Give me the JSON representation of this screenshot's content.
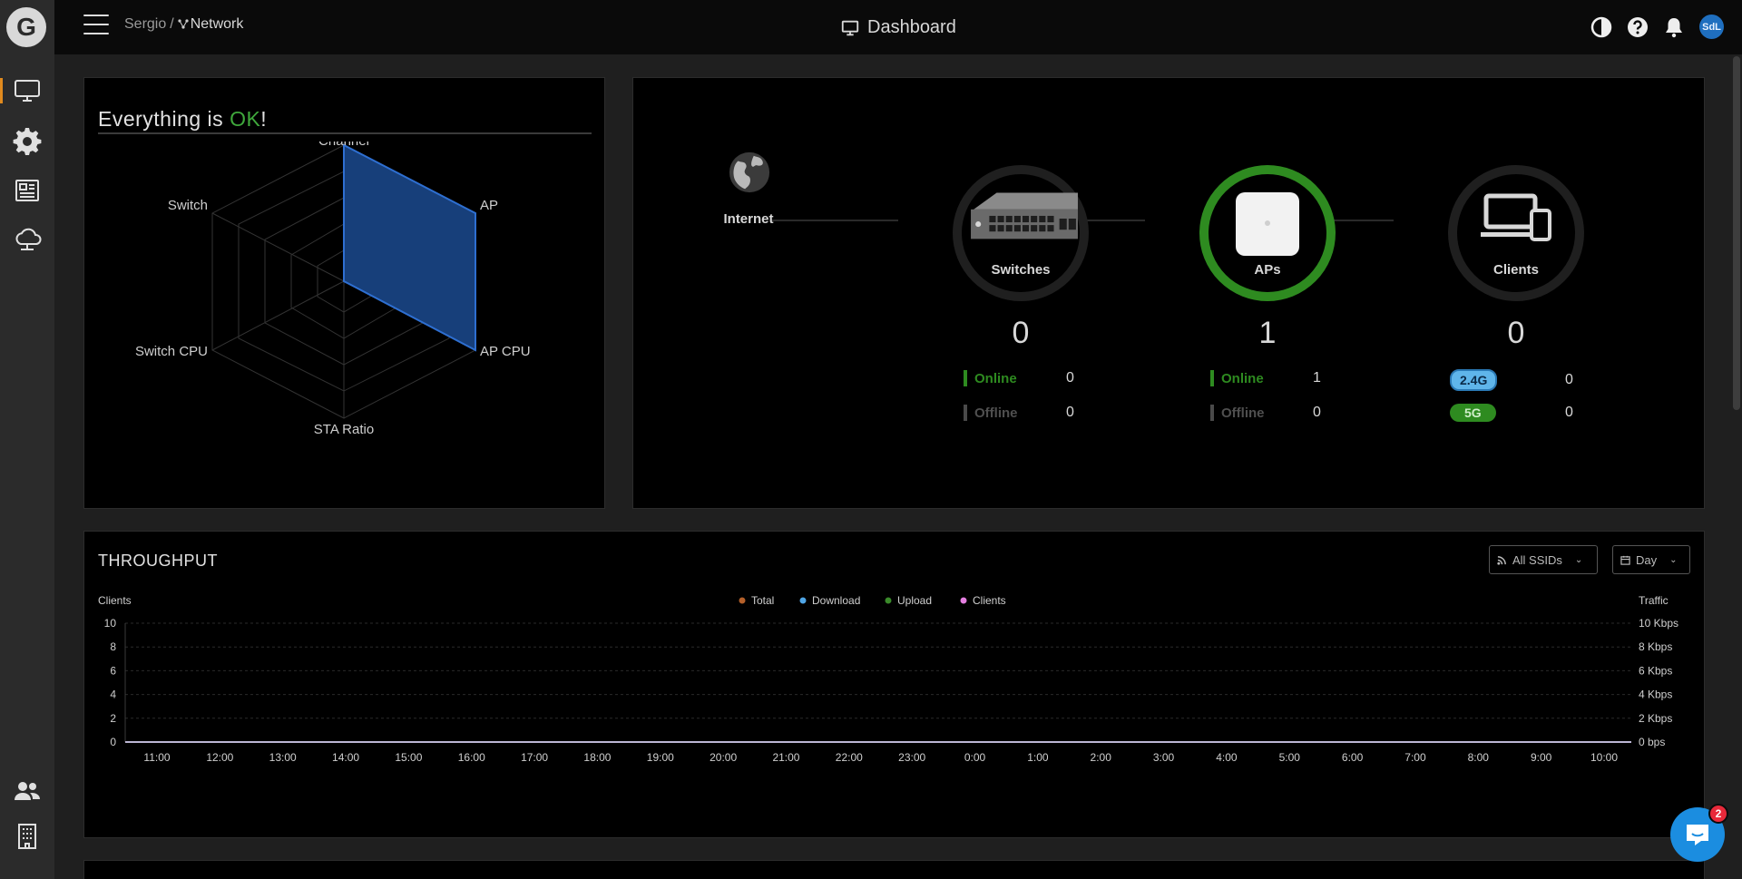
{
  "logo_letter": "G",
  "breadcrumb": {
    "org": "Sergio",
    "separator": "/",
    "network": "Network"
  },
  "page_title": "Dashboard",
  "user_initials": "SdL",
  "status_panel": {
    "title_prefix": "Everything is ",
    "title_ok": "OK",
    "title_suffix": "!",
    "radar_labels": {
      "channel": "Channel",
      "ap": "AP",
      "ap_cpu": "AP CPU",
      "sta_ratio": "STA Ratio",
      "switch_cpu": "Switch CPU",
      "switch": "Switch"
    }
  },
  "topology": {
    "internet_label": "Internet",
    "switches": {
      "label": "Switches",
      "count": "0",
      "online_label": "Online",
      "online": "0",
      "offline_label": "Offline",
      "offline": "0"
    },
    "aps": {
      "label": "APs",
      "count": "1",
      "online_label": "Online",
      "online": "1",
      "offline_label": "Offline",
      "offline": "0"
    },
    "clients": {
      "label": "Clients",
      "count": "0",
      "band1_label": "2.4G",
      "band1": "0",
      "band2_label": "5G",
      "band2": "0"
    }
  },
  "throughput": {
    "title": "THROUGHPUT",
    "ssid_filter": "All SSIDs",
    "period_filter": "Day"
  },
  "chat_badge": "2",
  "colors": {
    "ok": "#3fa83c",
    "radar_fill": "#173f7a",
    "radar_stroke": "#2e6fd1",
    "total": "#b5602a",
    "download": "#4fa5e6",
    "upload": "#3a8a2a",
    "clients": "#e47fe0"
  },
  "chart_data": {
    "type": "line",
    "legend": [
      "Total",
      "Download",
      "Upload",
      "Clients"
    ],
    "left_axis_label": "Clients",
    "right_axis_label": "Traffic",
    "y_left_ticks": [
      "10",
      "8",
      "6",
      "4",
      "2",
      "0"
    ],
    "y_right_ticks": [
      "10 Kbps",
      "8 Kbps",
      "6 Kbps",
      "4 Kbps",
      "2 Kbps",
      "0 bps"
    ],
    "x": [
      "11:00",
      "12:00",
      "13:00",
      "14:00",
      "15:00",
      "16:00",
      "17:00",
      "18:00",
      "19:00",
      "20:00",
      "21:00",
      "22:00",
      "23:00",
      "0:00",
      "1:00",
      "2:00",
      "3:00",
      "4:00",
      "5:00",
      "6:00",
      "7:00",
      "8:00",
      "9:00",
      "10:00"
    ],
    "series": [
      {
        "name": "Total",
        "values": [
          0,
          0,
          0,
          0,
          0,
          0,
          0,
          0,
          0,
          0,
          0,
          0,
          0,
          0,
          0,
          0,
          0,
          0,
          0,
          0,
          0,
          0,
          0,
          0
        ]
      },
      {
        "name": "Download",
        "values": [
          0,
          0,
          0,
          0,
          0,
          0,
          0,
          0,
          0,
          0,
          0,
          0,
          0,
          0,
          0,
          0,
          0,
          0,
          0,
          0,
          0,
          0,
          0,
          0
        ]
      },
      {
        "name": "Upload",
        "values": [
          0,
          0,
          0,
          0,
          0,
          0,
          0,
          0,
          0,
          0,
          0,
          0,
          0,
          0,
          0,
          0,
          0,
          0,
          0,
          0,
          0,
          0,
          0,
          0
        ]
      },
      {
        "name": "Clients",
        "values": [
          0,
          0,
          0,
          0,
          0,
          0,
          0,
          0,
          0,
          0,
          0,
          0,
          0,
          0,
          0,
          0,
          0,
          0,
          0,
          0,
          0,
          0,
          0,
          0
        ]
      }
    ],
    "ylim_left": [
      0,
      10
    ],
    "ylim_right_kbps": [
      0,
      10
    ],
    "grid": true,
    "legend_position": "top-center"
  }
}
